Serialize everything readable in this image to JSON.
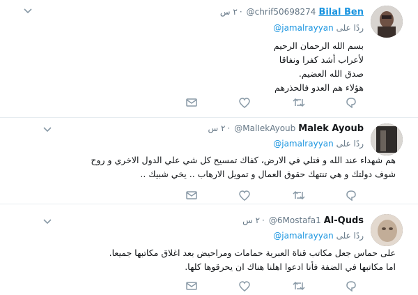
{
  "tweets": [
    {
      "name": "Bilal Ben",
      "handle": "@chrif50698274",
      "time": "٢ س",
      "reply_prefix": "ردًا على",
      "reply_to": "@jamalrayyan",
      "lines": [
        "بسم الله الرحمان الرحيم",
        "لأعراب أشد كفرا ونفاقا",
        "صدق الله العضيم.",
        "هؤلاء هم العدو فالحذرهم"
      ],
      "avatar_color": "#5a4a44"
    },
    {
      "name": "Malek Ayoub",
      "handle": "@MalIekAyoub",
      "time": "٢ س",
      "reply_prefix": "ردًا على",
      "reply_to": "@jamalrayyan",
      "lines": [
        "هم شهداء عند الله و قتلي في الارض، كفاك تمسيح كل شي علي الدول الاخري و روح",
        "شوف دولتك و هي تنتهك حقوق العمال و تمويل الارهاب .. يخي شبيك .."
      ],
      "avatar_color": "#3c3a38"
    },
    {
      "name": "Al-Quds",
      "handle": "@6Mostafa1",
      "time": "٢ س",
      "reply_prefix": "ردًا على",
      "reply_to": "@jamalrayyan",
      "lines": [
        "على حماس جعل مكاتب قناة العبرية حمامات ومراحيض بعد اغلاق مكاتبها جميعا.",
        "اما مكاتبها في الضفة فأنا ادعوا اهلنا هناك ان يحرقوها كلها."
      ],
      "avatar_color": "#c9b8a6"
    }
  ]
}
